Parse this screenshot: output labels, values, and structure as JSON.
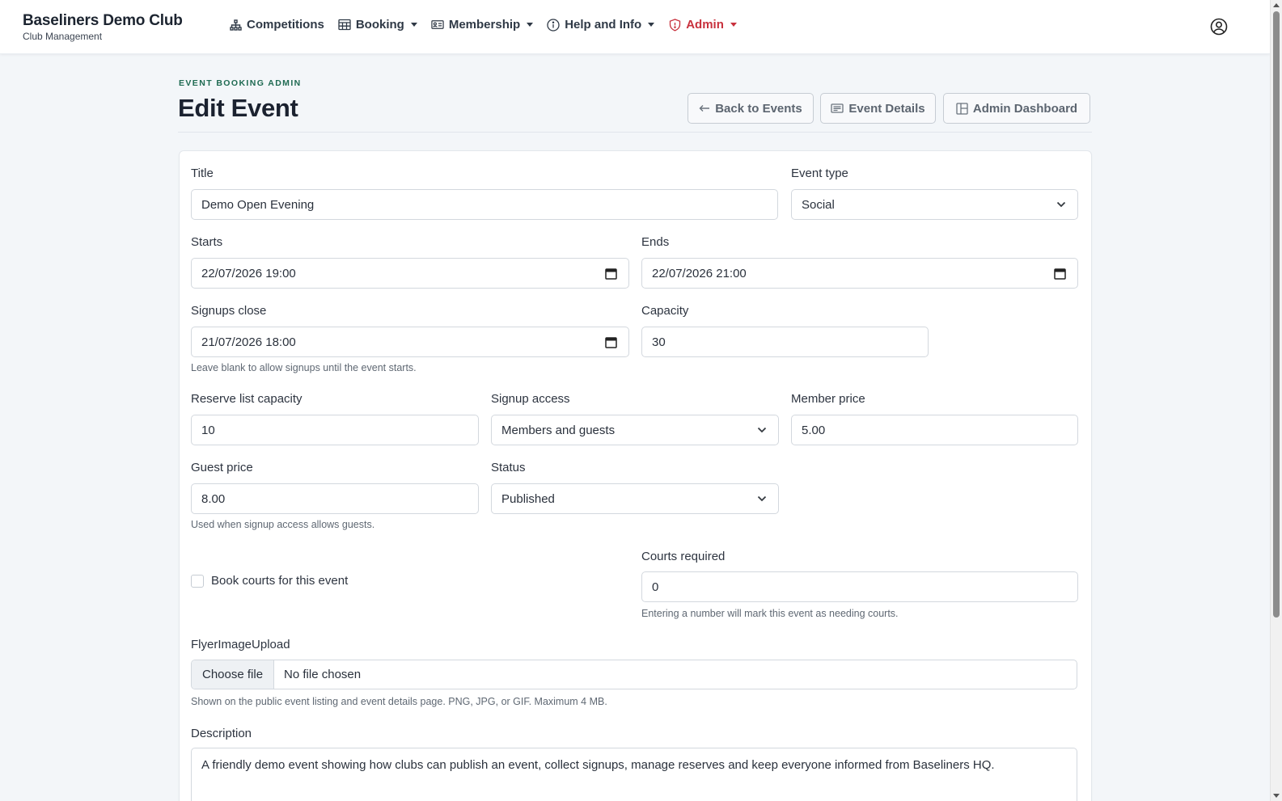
{
  "brand": {
    "title": "Baseliners Demo Club",
    "subtitle": "Club Management"
  },
  "nav": {
    "competitions": "Competitions",
    "booking": "Booking",
    "membership": "Membership",
    "help": "Help and Info",
    "admin": "Admin"
  },
  "colors": {
    "accent_green": "#1f6a52",
    "admin_red": "#c8313d"
  },
  "header": {
    "eyebrow": "EVENT BOOKING ADMIN",
    "title": "Edit Event",
    "back_label": "Back to Events",
    "details_label": "Event Details",
    "dashboard_label": "Admin Dashboard"
  },
  "form": {
    "title": {
      "label": "Title",
      "value": "Demo Open Evening"
    },
    "event_type": {
      "label": "Event type",
      "value": "Social"
    },
    "starts": {
      "label": "Starts",
      "value": "22/07/2026 19:00"
    },
    "ends": {
      "label": "Ends",
      "value": "22/07/2026 21:00"
    },
    "signups_close": {
      "label": "Signups close",
      "value": "21/07/2026 18:00",
      "help": "Leave blank to allow signups until the event starts."
    },
    "capacity": {
      "label": "Capacity",
      "value": "30"
    },
    "reserve_capacity": {
      "label": "Reserve list capacity",
      "value": "10"
    },
    "signup_access": {
      "label": "Signup access",
      "value": "Members and guests"
    },
    "member_price": {
      "label": "Member price",
      "value": "5.00"
    },
    "guest_price": {
      "label": "Guest price",
      "value": "8.00",
      "help": "Used when signup access allows guests."
    },
    "status": {
      "label": "Status",
      "value": "Published"
    },
    "book_courts": {
      "label": "Book courts for this event",
      "checked": false
    },
    "courts_required": {
      "label": "Courts required",
      "value": "0",
      "help": "Entering a number will mark this event as needing courts."
    },
    "flyer": {
      "label": "FlyerImageUpload",
      "button": "Choose file",
      "status": "No file chosen",
      "help": "Shown on the public event listing and event details page. PNG, JPG, or GIF. Maximum 4 MB."
    },
    "description": {
      "label": "Description",
      "value": "A friendly demo event showing how clubs can publish an event, collect signups, manage reserves and keep everyone informed from Baseliners HQ."
    }
  }
}
